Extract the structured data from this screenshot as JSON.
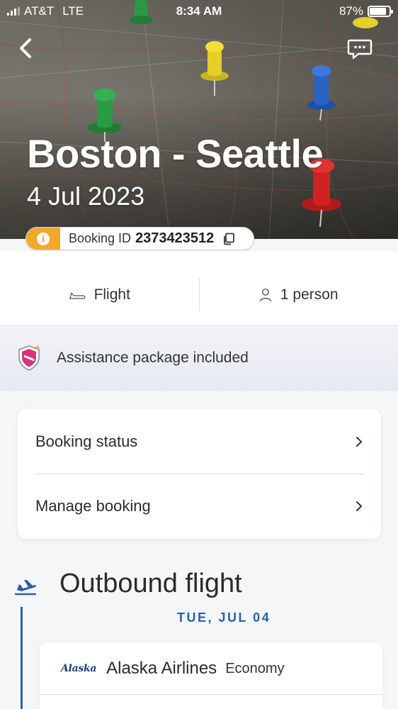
{
  "status_bar": {
    "carrier": "AT&T",
    "network": "LTE",
    "time": "8:34 AM",
    "battery": "87%",
    "battery_level": 0.87
  },
  "header": {
    "route": "Boston - Seattle",
    "date": "4 Jul 2023"
  },
  "booking": {
    "label": "Booking ID",
    "id": "2373423512"
  },
  "summary": {
    "type": "Flight",
    "travellers": "1 person"
  },
  "assistance": {
    "text": "Assistance package included"
  },
  "menu": {
    "items": [
      {
        "label": "Booking status"
      },
      {
        "label": "Manage booking"
      }
    ]
  },
  "outbound": {
    "title": "Outbound flight",
    "day": "TUE, JUL 04",
    "airline_logo": "Alaska",
    "airline": "Alaska Airlines",
    "cabin": "Economy"
  },
  "colors": {
    "accent": "#2d5fa8",
    "warning": "#f2a82a"
  }
}
